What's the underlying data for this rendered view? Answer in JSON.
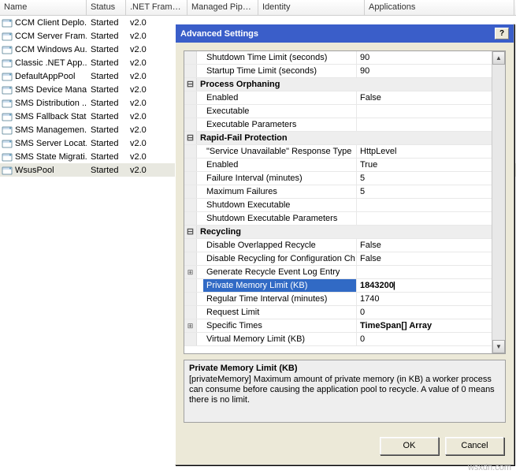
{
  "list": {
    "headers": {
      "name": "Name",
      "status": "Status",
      "net": ".NET Frame...",
      "managed": "Managed Pipeli...",
      "identity": "Identity",
      "apps": "Applications"
    },
    "rows": [
      {
        "name": "CCM Client Deplo...",
        "status": "Started",
        "ver": "v2.0"
      },
      {
        "name": "CCM Server Fram...",
        "status": "Started",
        "ver": "v2.0"
      },
      {
        "name": "CCM Windows Au...",
        "status": "Started",
        "ver": "v2.0"
      },
      {
        "name": "Classic .NET App...",
        "status": "Started",
        "ver": "v2.0"
      },
      {
        "name": "DefaultAppPool",
        "status": "Started",
        "ver": "v2.0"
      },
      {
        "name": "SMS Device Mana...",
        "status": "Started",
        "ver": "v2.0"
      },
      {
        "name": "SMS Distribution ...",
        "status": "Started",
        "ver": "v2.0"
      },
      {
        "name": "SMS Fallback Stat...",
        "status": "Started",
        "ver": "v2.0"
      },
      {
        "name": "SMS Managemen...",
        "status": "Started",
        "ver": "v2.0"
      },
      {
        "name": "SMS Server Locat...",
        "status": "Started",
        "ver": "v2.0"
      },
      {
        "name": "SMS State Migrati...",
        "status": "Started",
        "ver": "v2.0"
      },
      {
        "name": "WsusPool",
        "status": "Started",
        "ver": "v2.0",
        "selected": true
      }
    ]
  },
  "dialog": {
    "title": "Advanced Settings",
    "help": "?",
    "rows": [
      {
        "t": "item",
        "name": "Shutdown Time Limit (seconds)",
        "val": "90"
      },
      {
        "t": "item",
        "name": "Startup Time Limit (seconds)",
        "val": "90"
      },
      {
        "t": "group",
        "name": "Process Orphaning",
        "gutter": "⊟"
      },
      {
        "t": "item",
        "name": "Enabled",
        "val": "False"
      },
      {
        "t": "item",
        "name": "Executable",
        "val": ""
      },
      {
        "t": "item",
        "name": "Executable Parameters",
        "val": ""
      },
      {
        "t": "group",
        "name": "Rapid-Fail Protection",
        "gutter": "⊟"
      },
      {
        "t": "item",
        "name": "\"Service Unavailable\" Response Type",
        "val": "HttpLevel"
      },
      {
        "t": "item",
        "name": "Enabled",
        "val": "True"
      },
      {
        "t": "item",
        "name": "Failure Interval (minutes)",
        "val": "5"
      },
      {
        "t": "item",
        "name": "Maximum Failures",
        "val": "5"
      },
      {
        "t": "item",
        "name": "Shutdown Executable",
        "val": ""
      },
      {
        "t": "item",
        "name": "Shutdown Executable Parameters",
        "val": ""
      },
      {
        "t": "group",
        "name": "Recycling",
        "gutter": "⊟"
      },
      {
        "t": "item",
        "name": "Disable Overlapped Recycle",
        "val": "False"
      },
      {
        "t": "item",
        "name": "Disable Recycling for Configuration Ch",
        "val": "False"
      },
      {
        "t": "exp",
        "name": "Generate Recycle Event Log Entry",
        "gutter": "⊞"
      },
      {
        "t": "sel",
        "name": "Private Memory Limit (KB)",
        "val": "1843200",
        "bold": true
      },
      {
        "t": "item",
        "name": "Regular Time Interval (minutes)",
        "val": "1740"
      },
      {
        "t": "item",
        "name": "Request Limit",
        "val": "0"
      },
      {
        "t": "exp",
        "name": "Specific Times",
        "val": "TimeSpan[] Array",
        "gutter": "⊞",
        "bold": true
      },
      {
        "t": "item",
        "name": "Virtual Memory Limit (KB)",
        "val": "0"
      }
    ],
    "desc": {
      "title": "Private Memory Limit (KB)",
      "body": "[privateMemory] Maximum amount of private memory (in KB) a worker process can consume before causing the application pool to recycle.  A value of 0 means there is no limit."
    },
    "buttons": {
      "ok": "OK",
      "cancel": "Cancel"
    }
  },
  "watermark": "wsxdn.com"
}
